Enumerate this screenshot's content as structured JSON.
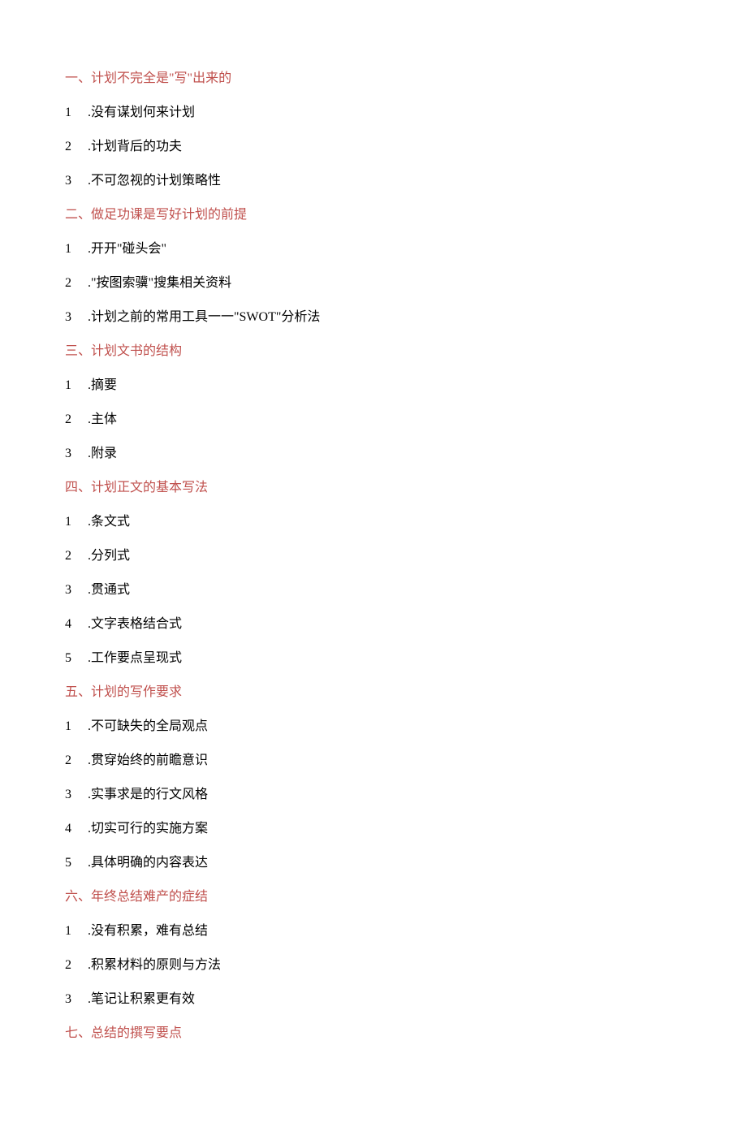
{
  "sections": [
    {
      "heading": "一、计划不完全是\"写\"出来的",
      "items": [
        {
          "num": "1",
          "text": ".没有谋划何来计划"
        },
        {
          "num": "2",
          "text": ".计划背后的功夫"
        },
        {
          "num": "3",
          "text": ".不可忽视的计划策略性"
        }
      ]
    },
    {
      "heading": "二、做足功课是写好计划的前提",
      "items": [
        {
          "num": "1",
          "text": ".开开\"碰头会\""
        },
        {
          "num": "2",
          "text": ".\"按图索骥\"搜集相关资料"
        },
        {
          "num": "3",
          "text": ".计划之前的常用工具一一\"SWOT\"分析法"
        }
      ]
    },
    {
      "heading": "三、计划文书的结构",
      "items": [
        {
          "num": "1",
          "text": ".摘要"
        },
        {
          "num": "2",
          "text": ".主体"
        },
        {
          "num": "3",
          "text": ".附录"
        }
      ]
    },
    {
      "heading": "四、计划正文的基本写法",
      "items": [
        {
          "num": "1",
          "text": ".条文式"
        },
        {
          "num": "2",
          "text": ".分列式"
        },
        {
          "num": "3",
          "text": ".贯通式"
        },
        {
          "num": "4",
          "text": ".文字表格结合式"
        },
        {
          "num": "5",
          "text": ".工作要点呈现式"
        }
      ]
    },
    {
      "heading": "五、计划的写作要求",
      "items": [
        {
          "num": "1",
          "text": ".不可缺失的全局观点"
        },
        {
          "num": "2",
          "text": ".贯穿始终的前瞻意识"
        },
        {
          "num": "3",
          "text": ".实事求是的行文风格"
        },
        {
          "num": "4",
          "text": ".切实可行的实施方案"
        },
        {
          "num": "5",
          "text": ".具体明确的内容表达"
        }
      ]
    },
    {
      "heading": "六、年终总结难产的症结",
      "items": [
        {
          "num": "1",
          "text": ".没有积累，难有总结"
        },
        {
          "num": "2",
          "text": ".积累材料的原则与方法"
        },
        {
          "num": "3",
          "text": ".笔记让积累更有效"
        }
      ]
    },
    {
      "heading": "七、总结的撰写要点",
      "items": []
    }
  ]
}
